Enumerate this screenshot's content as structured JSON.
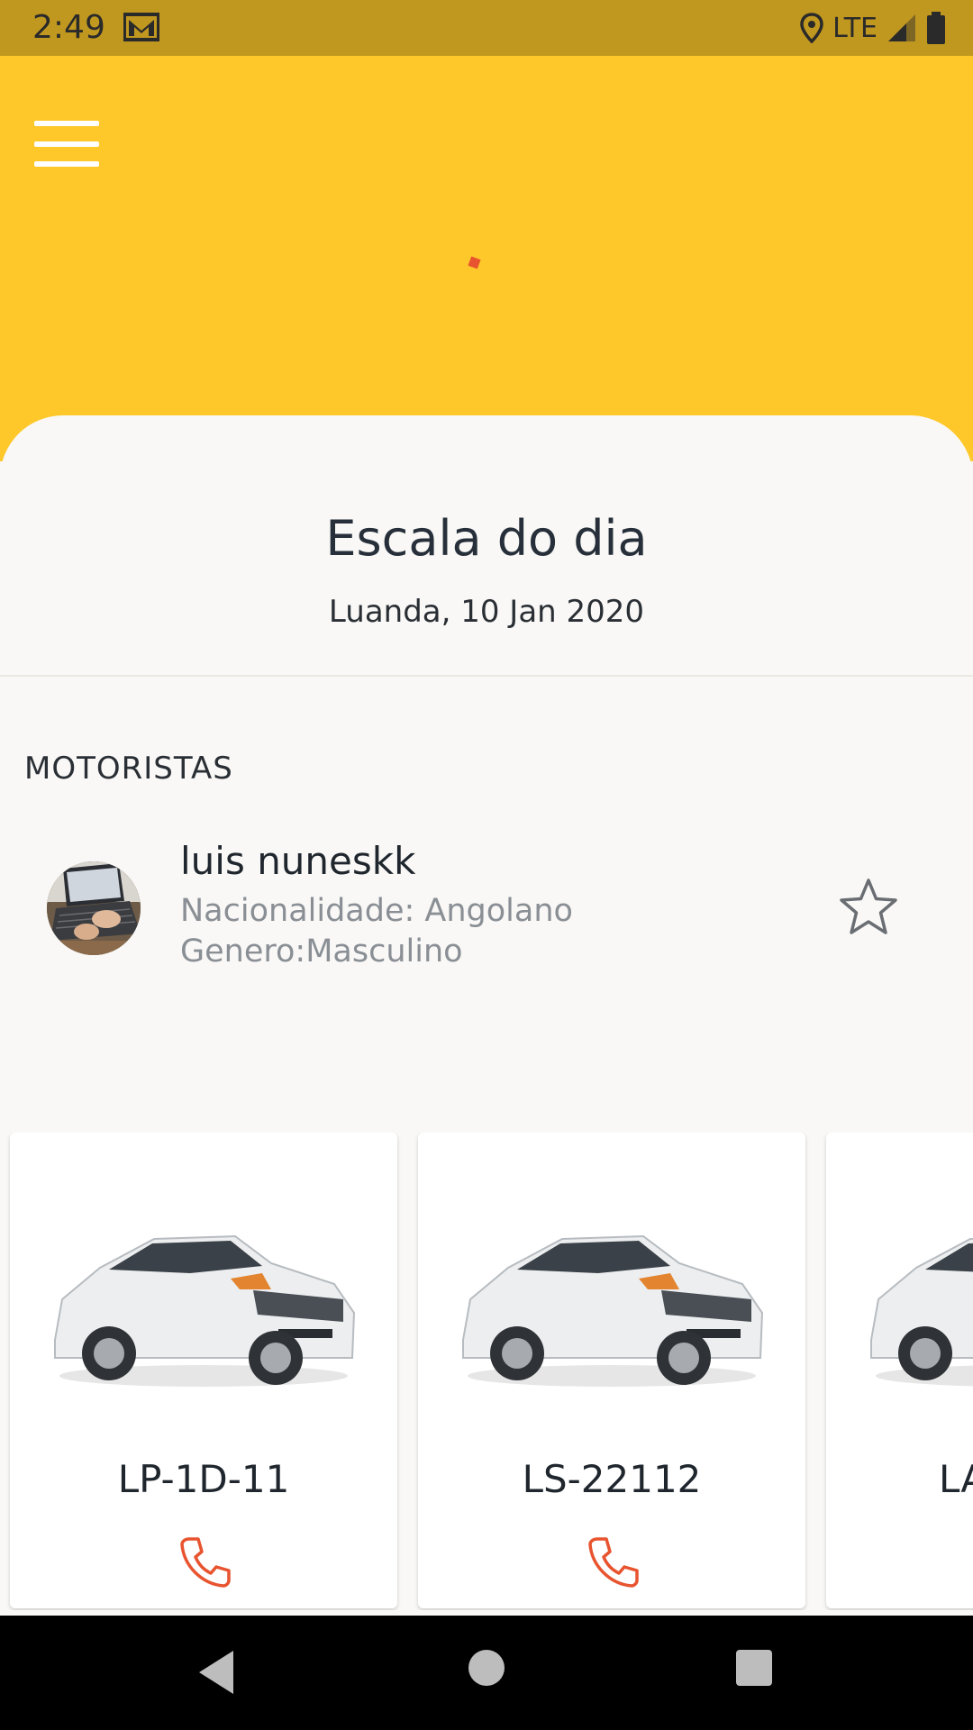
{
  "status_bar": {
    "time": "2:49",
    "network": "LTE"
  },
  "header": {
    "menu_icon": "hamburger-menu-icon"
  },
  "schedule": {
    "title": "Escala do dia",
    "date": "Luanda, 10 Jan 2020"
  },
  "drivers": {
    "section_label": "MOTORISTAS",
    "items": [
      {
        "name": "luis nuneskk",
        "nationality": "Nacionalidade: Angolano",
        "gender": "Genero:Masculino",
        "favorite_icon": "star-outline-icon"
      }
    ]
  },
  "vehicles": [
    {
      "plate": "LP-1D-11",
      "call_icon": "phone-icon"
    },
    {
      "plate": "LS-22112",
      "call_icon": "phone-icon"
    },
    {
      "plate": "LA",
      "call_icon": "phone-icon"
    }
  ],
  "colors": {
    "status_bar": "#c1981f",
    "header": "#fec82a",
    "accent": "#e8542f",
    "background": "#f9f8f6",
    "text_dark": "#27303a",
    "text_muted": "#8a8f95"
  }
}
